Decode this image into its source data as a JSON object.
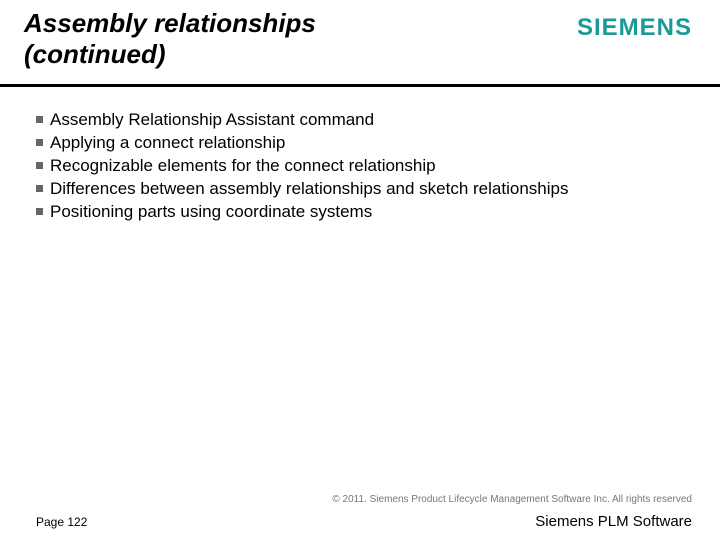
{
  "header": {
    "title": "Assembly relationships (continued)",
    "logo": "SIEMENS"
  },
  "bullets": [
    "Assembly Relationship Assistant command",
    "Applying a connect relationship",
    "Recognizable elements for the connect relationship",
    "Differences between assembly relationships and sketch relationships",
    "Positioning parts using coordinate systems"
  ],
  "footer": {
    "copyright": "© 2011. Siemens Product Lifecycle Management Software Inc. All rights reserved",
    "page": "Page 122",
    "plm": "Siemens PLM Software"
  }
}
